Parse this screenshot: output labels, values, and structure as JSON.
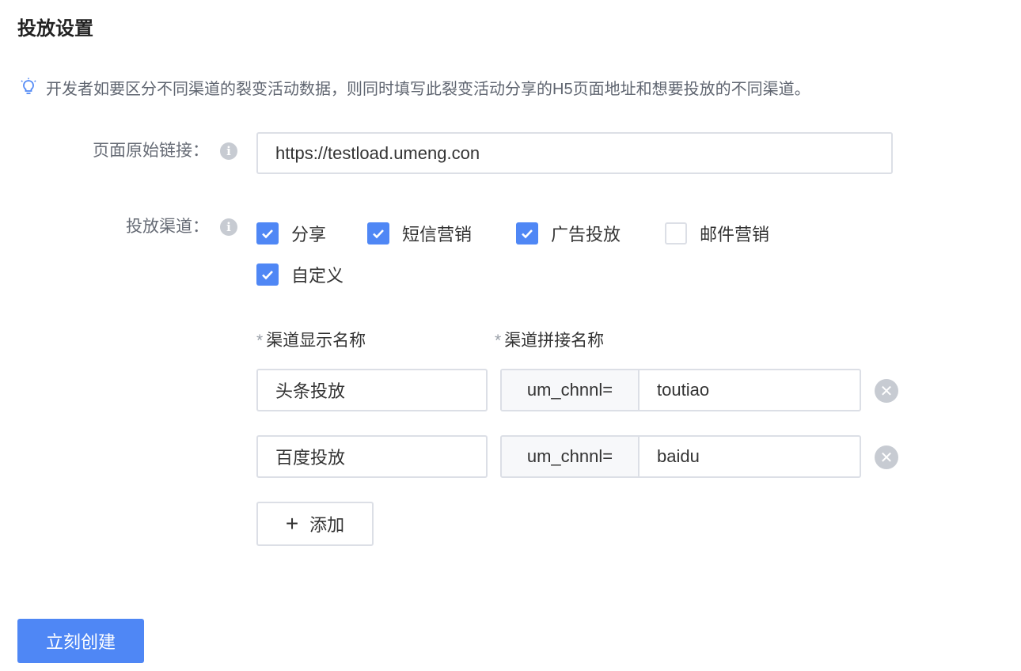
{
  "section": {
    "title": "投放设置",
    "tip": "开发者如要区分不同渠道的裂变活动数据，则同时填写此裂变活动分享的H5页面地址和想要投放的不同渠道。"
  },
  "form": {
    "url": {
      "label": "页面原始链接：",
      "value": "https://testload.umeng.con"
    },
    "channels": {
      "label": "投放渠道：",
      "options": [
        {
          "label": "分享",
          "checked": true
        },
        {
          "label": "短信营销",
          "checked": true
        },
        {
          "label": "广告投放",
          "checked": true
        },
        {
          "label": "邮件营销",
          "checked": false
        },
        {
          "label": "自定义",
          "checked": true
        }
      ]
    },
    "custom_channels": {
      "display_name_header": "渠道显示名称",
      "param_name_header": "渠道拼接名称",
      "required_mark": "*",
      "rows": [
        {
          "display_name": "头条投放",
          "prefix": "um_chnnl=",
          "param": "toutiao"
        },
        {
          "display_name": "百度投放",
          "prefix": "um_chnnl=",
          "param": "baidu"
        }
      ],
      "add_label": "添加",
      "add_icon": "+"
    }
  },
  "submit_label": "立刻创建",
  "icons": {
    "info": "i",
    "remove": "✕"
  },
  "colors": {
    "primary": "#4f87f5",
    "border": "#dcdfe6",
    "muted_icon": "#c7cbd2"
  }
}
